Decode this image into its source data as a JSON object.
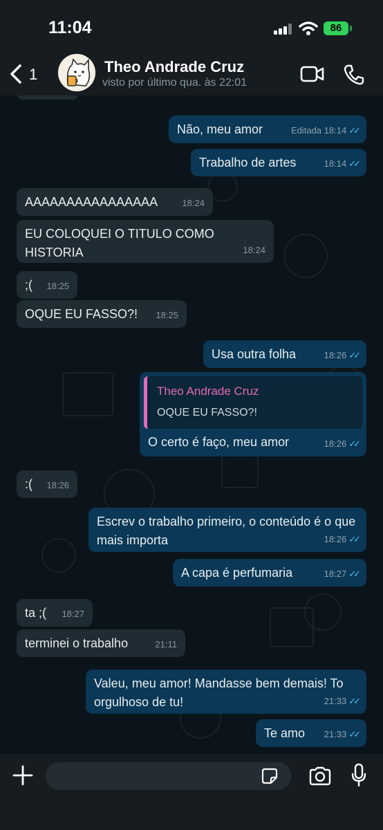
{
  "status_bar": {
    "time": "11:04",
    "battery": "86"
  },
  "header": {
    "back_count": "1",
    "contact_name": "Theo Andrade Cruz",
    "last_seen": "visto por último qua. às 22:01"
  },
  "messages": [
    {
      "dir": "out",
      "text": "Não, meu amor",
      "edited": "Editada",
      "time": "18:14"
    },
    {
      "dir": "out",
      "text": "Trabalho de artes",
      "time": "18:14"
    },
    {
      "dir": "in",
      "text": "AAAAAAAAAAAAAAAA",
      "time": "18:24"
    },
    {
      "dir": "in",
      "text": "EU COLOQUEI O TITULO COMO HISTORIA",
      "time": "18:24"
    },
    {
      "dir": "in",
      "text": ";(",
      "time": "18:25"
    },
    {
      "dir": "in",
      "text": "OQUE EU FASSO?!",
      "time": "18:25"
    },
    {
      "dir": "out",
      "text": "Usa outra folha",
      "time": "18:26"
    },
    {
      "dir": "out",
      "quote_name": "Theo Andrade Cruz",
      "quote_text": "OQUE EU FASSO?!",
      "text": "O certo é faço, meu amor",
      "time": "18:26"
    },
    {
      "dir": "in",
      "text": ":(",
      "time": "18:26"
    },
    {
      "dir": "out",
      "text": "Escrev o trabalho primeiro, o conteúdo é o que mais importa",
      "time": "18:26"
    },
    {
      "dir": "out",
      "text": "A capa é perfumaria",
      "time": "18:27"
    },
    {
      "dir": "in",
      "text": "ta ;(",
      "time": "18:27"
    },
    {
      "dir": "in",
      "text": "terminei o trabalho",
      "time": "21:11"
    },
    {
      "dir": "out",
      "text": "Valeu, meu amor! Mandasse bem demais! To orgulhoso de tu!",
      "time": "21:33"
    },
    {
      "dir": "out",
      "text": "Te amo",
      "time": "21:33"
    }
  ],
  "colors": {
    "incoming": "#1f2c33",
    "outgoing": "#0a3856",
    "quote_accent": "#e26ab8",
    "read_tick": "#53bdeb"
  },
  "icons": [
    "back-chevron",
    "video-call",
    "phone-call",
    "plus",
    "sticker",
    "camera",
    "microphone"
  ]
}
